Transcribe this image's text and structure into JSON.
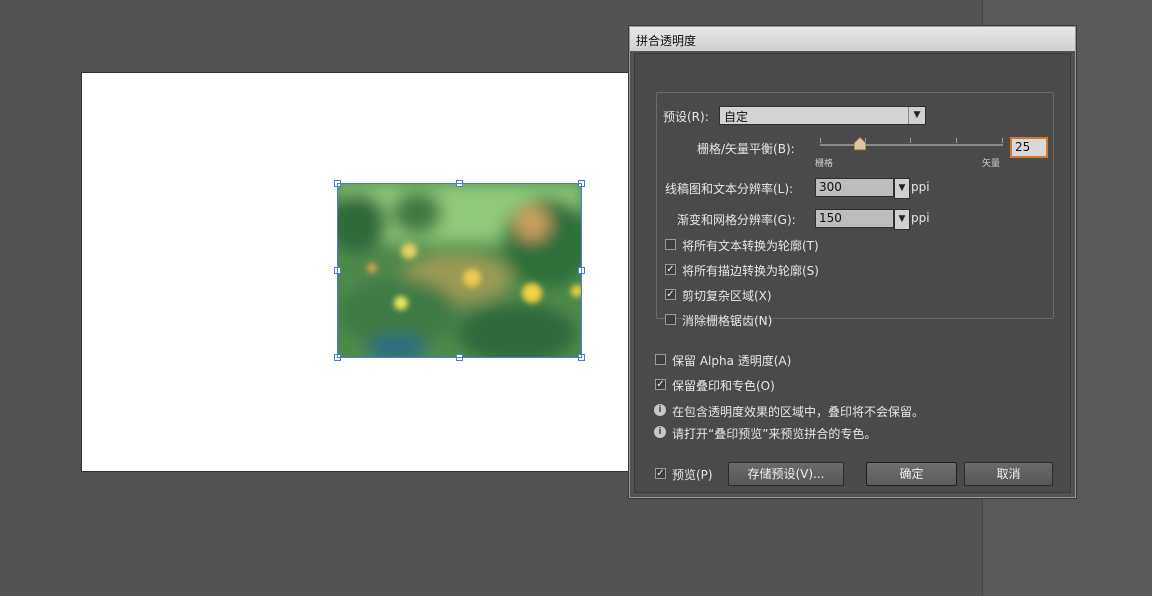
{
  "dialog": {
    "title": "拼合透明度",
    "preset_label": "预设(R):",
    "preset_value": "自定",
    "balance_label": "栅格/矢量平衡(B):",
    "balance_min_label": "栅格",
    "balance_max_label": "矢量",
    "balance_value": "25",
    "line_art_label": "线稿图和文本分辨率(L):",
    "line_art_value": "300",
    "line_art_unit": "ppi",
    "gradient_label": "渐变和网格分辨率(G):",
    "gradient_value": "150",
    "gradient_unit": "ppi",
    "options": [
      {
        "label": "将所有文本转换为轮廓(T)",
        "checked": false
      },
      {
        "label": "将所有描边转换为轮廓(S)",
        "checked": true
      },
      {
        "label": "剪切复杂区域(X)",
        "checked": true
      },
      {
        "label": "消除栅格锯齿(N)",
        "checked": false
      }
    ],
    "preserve_alpha_label": "保留 Alpha 透明度(A)",
    "preserve_alpha_checked": false,
    "preserve_overprint_label": "保留叠印和专色(O)",
    "preserve_overprint_checked": true,
    "info1": "在包含透明度效果的区域中，叠印将不会保留。",
    "info2": "请打开“叠印预览”来预览拼合的专色。",
    "preview_label": "预览(P)",
    "preview_checked": true,
    "save_preset_label": "存储预设(V)...",
    "ok_label": "确定",
    "cancel_label": "取消",
    "check_mark": "✓",
    "dropdown_arrow": "▼",
    "info_glyph": "i"
  },
  "colors": {
    "panel": "#535353",
    "dialog_body": "#4a4a4a",
    "focus_outline": "#d07a30",
    "selection": "#4a7fd0"
  },
  "icons": [
    "info-icon",
    "dropdown-arrow-icon",
    "slider-thumb-icon",
    "checkbox-icon"
  ]
}
